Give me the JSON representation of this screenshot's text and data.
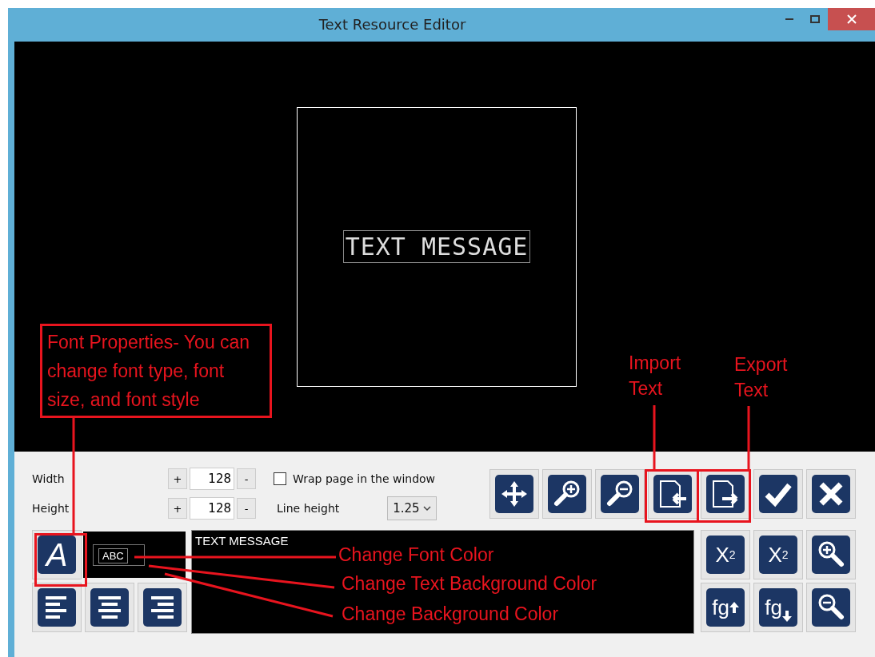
{
  "window": {
    "title": "Text Resource Editor"
  },
  "preview": {
    "text": "TEXT MESSAGE"
  },
  "size_fields": [
    {
      "label": "Width",
      "plus": "+",
      "value": "128",
      "minus": "-"
    },
    {
      "label": "Height",
      "plus": "+",
      "value": "128",
      "minus": "-"
    }
  ],
  "wrap_option": {
    "label": "Wrap page in the window",
    "checked": false
  },
  "line_height": {
    "label": "Line height",
    "value": "1.25"
  },
  "toolbar": [
    {
      "kind": "move"
    },
    {
      "kind": "zoom-in"
    },
    {
      "kind": "zoom-out"
    },
    {
      "kind": "import"
    },
    {
      "kind": "export"
    },
    {
      "kind": "confirm"
    },
    {
      "kind": "cancel"
    }
  ],
  "font_button": {
    "label": "A"
  },
  "color_preview": {
    "text": "ABC"
  },
  "align_buttons": [
    {
      "kind": "left"
    },
    {
      "kind": "center"
    },
    {
      "kind": "right"
    }
  ],
  "editor": {
    "value": "TEXT MESSAGE"
  },
  "format_buttons": [
    {
      "kind": "superscript",
      "label": "X",
      "index": "2"
    },
    {
      "kind": "subscript",
      "label": "X",
      "index": "2"
    },
    {
      "kind": "zoom-in"
    },
    {
      "kind": "raise",
      "label": "fg"
    },
    {
      "kind": "lower",
      "label": "fg"
    },
    {
      "kind": "zoom-out"
    }
  ],
  "annotations": [
    {
      "text": "Font Properties- You can change font type, font size, and font style"
    },
    {
      "text": "Import Text"
    },
    {
      "text": "Export Text"
    },
    {
      "text": "Change Font Color"
    },
    {
      "text": "Change Text Background Color"
    },
    {
      "text": "Change Background Color"
    }
  ]
}
